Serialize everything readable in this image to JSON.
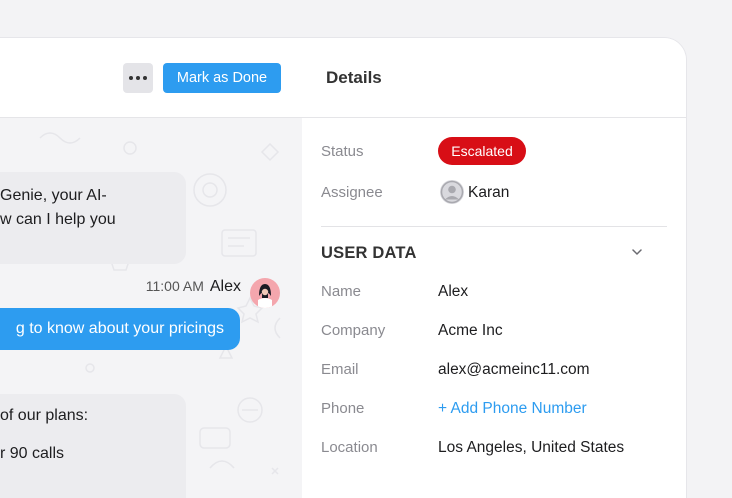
{
  "chat": {
    "more_icon": "more-horizontal-icon",
    "mark_done_label": "Mark as Done",
    "messages": [
      {
        "from": "bot",
        "lines": [
          "Genie, your AI-",
          "w can I help you"
        ]
      },
      {
        "from": "user",
        "time": "11:00 AM",
        "name": "Alex",
        "text": "g to know about your pricings"
      },
      {
        "from": "bot",
        "lines": [
          " of our plans:",
          "r 90 calls"
        ]
      }
    ]
  },
  "details": {
    "title": "Details",
    "status_label": "Status",
    "status_value": "Escalated",
    "assignee_label": "Assignee",
    "assignee_name": "Karan",
    "user_data": {
      "title": "USER DATA",
      "fields": [
        {
          "label": "Name",
          "value": "Alex"
        },
        {
          "label": "Company",
          "value": "Acme Inc"
        },
        {
          "label": "Email",
          "value": "alex@acmeinc11.com"
        },
        {
          "label": "Phone",
          "value": "+ Add Phone Number"
        },
        {
          "label": "Location",
          "value": "Los Angeles, United States"
        }
      ]
    }
  },
  "colors": {
    "accent": "#2d9cf0",
    "escalated": "#d80e16"
  }
}
